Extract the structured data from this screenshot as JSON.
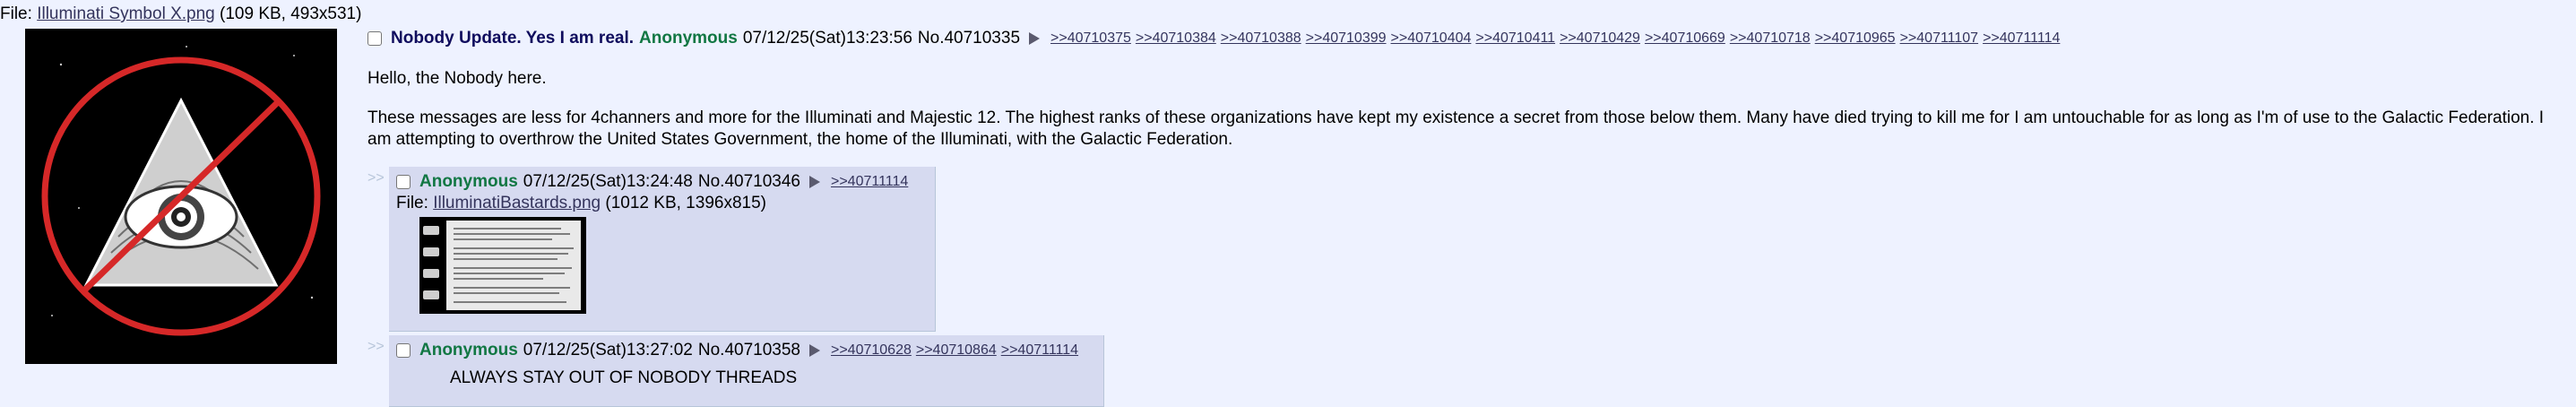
{
  "op": {
    "file_prefix": "File: ",
    "file_name": "Illuminati Symbol X.png",
    "file_meta": " (109 KB, 493x531)",
    "subject": "Nobody Update. Yes I am real.",
    "name": "Anonymous",
    "datetime": "07/12/25(Sat)13:23:56",
    "post_no": "No.40710335",
    "backlinks": [
      ">>40710375",
      ">>40710384",
      ">>40710388",
      ">>40710399",
      ">>40710404",
      ">>40710411",
      ">>40710429",
      ">>40710669",
      ">>40710718",
      ">>40710965",
      ">>40711107",
      ">>40711114"
    ],
    "body": [
      "Hello, the Nobody here.",
      "These messages are less for 4channers and more for the Illuminati and Majestic 12. The highest ranks of these organizations have kept my existence a secret from those below them. Many have died trying to kill me for I am untouchable for as long as I'm of use to the Galactic Federation. I am attempting to overthrow the United States Government, the home of the Illuminati, with the Galactic Federation."
    ]
  },
  "replies": [
    {
      "arrows": ">>",
      "name": "Anonymous",
      "datetime": "07/12/25(Sat)13:24:48",
      "post_no": "No.40710346",
      "backlinks": [
        ">>40711114"
      ],
      "file_prefix": "File: ",
      "file_name": "IlluminatiBastards.png",
      "file_meta": " (1012 KB, 1396x815)"
    },
    {
      "arrows": ">>",
      "name": "Anonymous",
      "datetime": "07/12/25(Sat)13:27:02",
      "post_no": "No.40710358",
      "backlinks": [
        ">>40710628",
        ">>40710864",
        ">>40711114"
      ],
      "body_partial": "ALWAYS STAY OUT OF NOBODY THREADS"
    }
  ],
  "colors": {
    "background": "#eef2ff",
    "reply_background": "#d6daf0",
    "subject": "#0f0c5d",
    "name": "#117743",
    "link": "#34345c"
  },
  "icons": {
    "post_menu": "triangle-right-icon",
    "op_image": "illuminati-eye-pyramid-crossed-out"
  }
}
